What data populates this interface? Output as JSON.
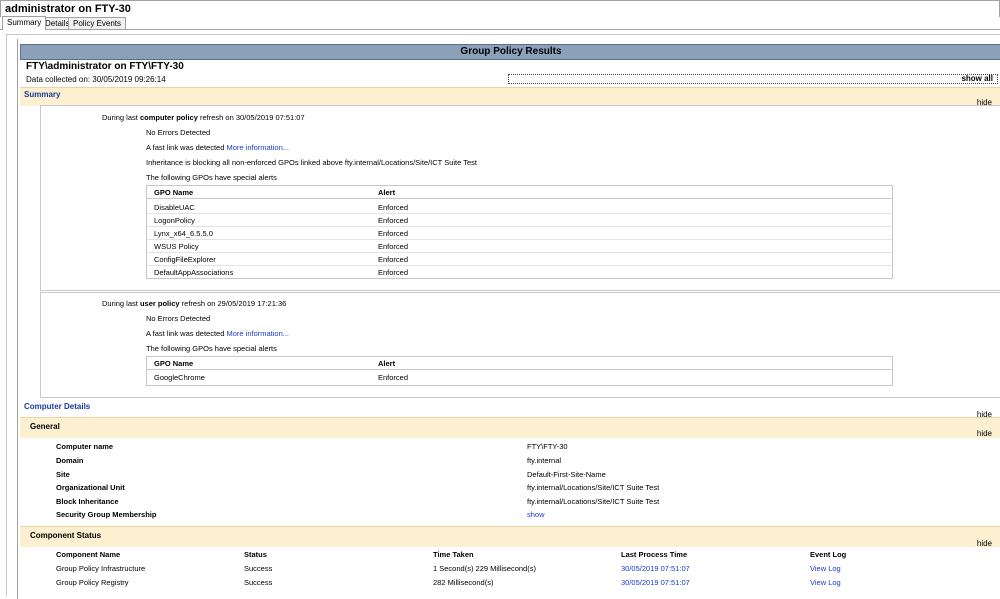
{
  "window": {
    "title": "administrator on FTY-30"
  },
  "tabs": [
    {
      "label": "Summary"
    },
    {
      "label": "Details"
    },
    {
      "label": "Policy Events"
    }
  ],
  "report": {
    "banner": "Group Policy Results",
    "heading": "FTY\\administrator on FTY\\FTY-30",
    "collected": "Data collected on: 30/05/2019 09:26:14",
    "show_all": "show all"
  },
  "summary": {
    "title": "Summary",
    "hide": "hide",
    "computer": {
      "prefix": "During last",
      "policy": "computer policy",
      "suffix": "refresh on 30/05/2019 07:51:07",
      "no_errors": "No Errors Detected",
      "fast_link": "A fast link was detected",
      "more_info": "More information...",
      "inheritance": "Inheritance is blocking all non-enforced GPOs linked above fty.internal/Locations/Site/ICT Suite Test",
      "alerts_intro": "The following GPOs have special alerts",
      "col_gpo": "GPO Name",
      "col_alert": "Alert",
      "rows": [
        {
          "gpo": "DisableUAC",
          "alert": "Enforced"
        },
        {
          "gpo": "LogonPolicy",
          "alert": "Enforced"
        },
        {
          "gpo": "Lynx_x64_6.5.5.0",
          "alert": "Enforced"
        },
        {
          "gpo": "WSUS Policy",
          "alert": "Enforced"
        },
        {
          "gpo": "ConfigFileExplorer",
          "alert": "Enforced"
        },
        {
          "gpo": "DefaultAppAssociations",
          "alert": "Enforced"
        }
      ]
    },
    "user": {
      "prefix": "During last",
      "policy": "user policy",
      "suffix": "refresh on 29/05/2019 17:21:36",
      "no_errors": "No Errors Detected",
      "fast_link": "A fast link was detected",
      "more_info": "More information...",
      "alerts_intro": "The following GPOs have special alerts",
      "col_gpo": "GPO Name",
      "col_alert": "Alert",
      "rows": [
        {
          "gpo": "GoogleChrome",
          "alert": "Enforced"
        }
      ]
    }
  },
  "computer_details": {
    "title": "Computer Details",
    "hide": "hide",
    "general": {
      "title": "General",
      "hide": "hide",
      "fields": [
        {
          "label": "Computer name",
          "value": "FTY\\FTY-30"
        },
        {
          "label": "Domain",
          "value": "fty.internal"
        },
        {
          "label": "Site",
          "value": "Default-First-Site-Name"
        },
        {
          "label": "Organizational Unit",
          "value": "fty.internal/Locations/Site/ICT Suite Test"
        },
        {
          "label": "Block Inheritance",
          "value": "fty.internal/Locations/Site/ICT Suite Test"
        },
        {
          "label": "Security Group Membership",
          "value": "show"
        }
      ]
    },
    "component_status": {
      "title": "Component Status",
      "hide": "hide",
      "columns": [
        "Component Name",
        "Status",
        "Time Taken",
        "Last Process Time",
        "Event Log"
      ],
      "rows": [
        {
          "name": "Group Policy Infrastructure",
          "status": "Success",
          "time": "1 Second(s) 229 Millisecond(s)",
          "last": "30/05/2019 07:51:07",
          "log": "View Log"
        },
        {
          "name": "Group Policy Registry",
          "status": "Success",
          "time": "282 Millisecond(s)",
          "last": "30/05/2019 07:51:07",
          "log": "View Log"
        }
      ]
    }
  }
}
